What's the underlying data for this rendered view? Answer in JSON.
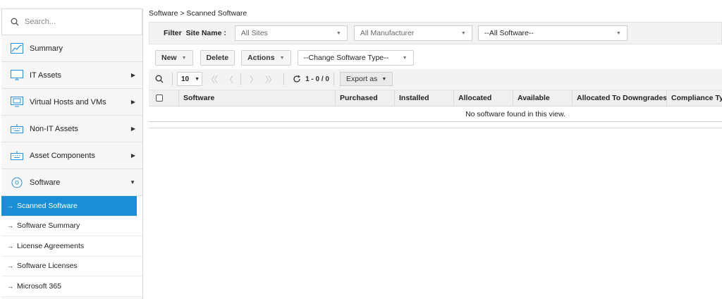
{
  "sidebar": {
    "search_placeholder": "Search...",
    "items": [
      {
        "label": "Summary",
        "icon": "chart-icon"
      },
      {
        "label": "IT Assets",
        "icon": "monitor-icon"
      },
      {
        "label": "Virtual Hosts and VMs",
        "icon": "vm-icon"
      },
      {
        "label": "Non-IT Assets",
        "icon": "keyboard-icon"
      },
      {
        "label": "Asset Components",
        "icon": "keyboard-icon"
      },
      {
        "label": "Software",
        "icon": "disc-icon"
      }
    ],
    "sub_items": [
      {
        "label": "Scanned Software"
      },
      {
        "label": "Software Summary"
      },
      {
        "label": "License Agreements"
      },
      {
        "label": "Software Licenses"
      },
      {
        "label": "Microsoft 365"
      }
    ]
  },
  "breadcrumb": "Software > Scanned Software",
  "filter": {
    "label": "Filter",
    "site_label": "Site Name :",
    "site_value": "All Sites",
    "manufacturer_value": "All Manufacturer",
    "software_value": "--All Software--"
  },
  "toolbar": {
    "new_label": "New",
    "delete_label": "Delete",
    "actions_label": "Actions",
    "change_type_value": "--Change Software Type--"
  },
  "pager": {
    "page_size": "10",
    "range": "1 - 0 / 0",
    "export_label": "Export as"
  },
  "table": {
    "columns": [
      "Software",
      "Purchased",
      "Installed",
      "Allocated",
      "Available",
      "Allocated To Downgrades",
      "Compliance Type"
    ],
    "empty_message": "No software found in this view."
  },
  "colors": {
    "accent": "#1a8fd8",
    "icon_blue": "#2b8fd6"
  }
}
